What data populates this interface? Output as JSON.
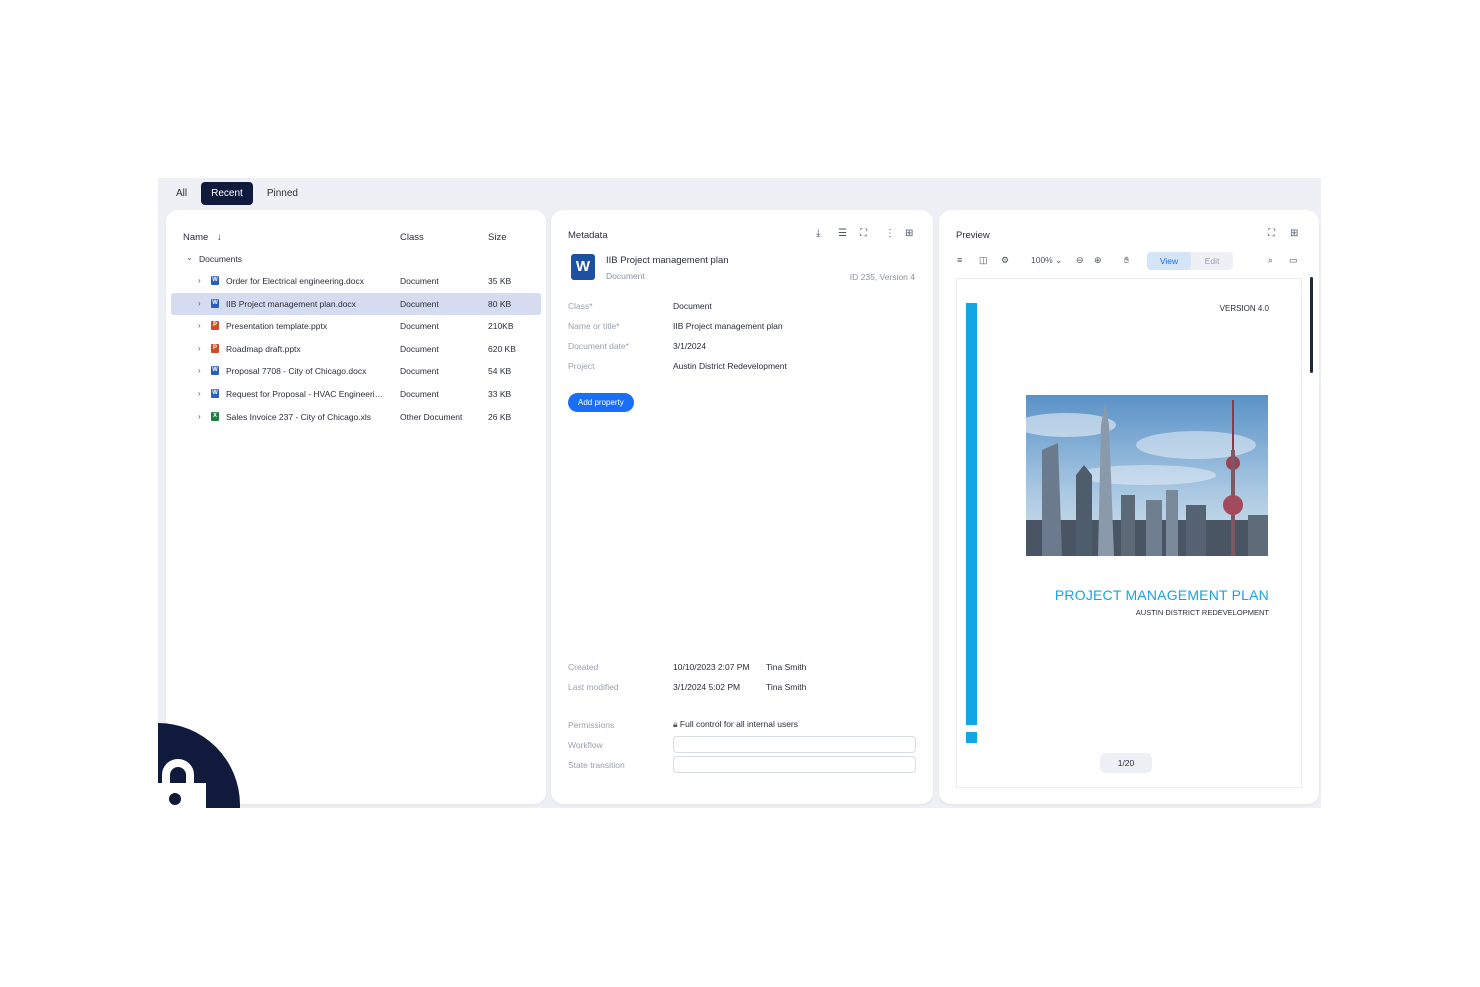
{
  "tabs": [
    "All",
    "Recent",
    "Pinned"
  ],
  "list": {
    "col_name": "Name",
    "sort_icon": "arrow-down",
    "col_class": "Class",
    "col_size": "Size",
    "folder": "Documents",
    "files": [
      {
        "name": "Order for Electrical engineering.docx",
        "class": "Document",
        "size": "35 KB",
        "type": "word",
        "color": "#2b5fbd",
        "letter": "W"
      },
      {
        "name": "IIB Project management plan.docx",
        "class": "Document",
        "size": "80 KB",
        "type": "word",
        "color": "#2b5fbd",
        "letter": "W"
      },
      {
        "name": "Presentation template.pptx",
        "class": "Document",
        "size": "210KB",
        "type": "powerpoint",
        "color": "#d04a23",
        "letter": "P"
      },
      {
        "name": "Roadmap draft.pptx",
        "class": "Document",
        "size": "620 KB",
        "type": "powerpoint",
        "color": "#d04a23",
        "letter": "P"
      },
      {
        "name": "Proposal 7708 - City of Chicago.docx",
        "class": "Document",
        "size": "54 KB",
        "type": "word",
        "color": "#2b5fbd",
        "letter": "W"
      },
      {
        "name": "Request for Proposal - HVAC Engineerin...",
        "class": "Document",
        "size": "33 KB",
        "type": "word",
        "color": "#2b5fbd",
        "letter": "W"
      },
      {
        "name": "Sales Invoice 237 - City of Chicago.xls",
        "class": "Other Document",
        "size": "26 KB",
        "type": "excel",
        "color": "#1e7d45",
        "letter": "X"
      }
    ]
  },
  "metadata": {
    "title": "Metadata",
    "doc_icon_letter": "W",
    "doc_title": "IIB Project management plan",
    "doc_class": "Document",
    "doc_id": "ID 235, Version 4",
    "props": [
      {
        "label": "Class*",
        "value": "Document"
      },
      {
        "label": "Name or title*",
        "value": "IIB Project management plan"
      },
      {
        "label": "Document date*",
        "value": "3/1/2024"
      },
      {
        "label": "Project",
        "value": "Austin District Redevelopment"
      }
    ],
    "add_property": "Add property",
    "created_label": "Created",
    "created_date": "10/10/2023 2:07 PM",
    "created_by": "Tina Smith",
    "modified_label": "Last modified",
    "modified_date": "3/1/2024 5:02 PM",
    "modified_by": "Tina Smith",
    "permissions_label": "Permissions",
    "permissions_value": "Full control for all internal users",
    "workflow_label": "Workflow",
    "workflow_value": "",
    "state_label": "State transition",
    "state_value": ""
  },
  "preview": {
    "title": "Preview",
    "zoom": "100%",
    "view": "View",
    "edit": "Edit",
    "version": "VERSION 4.0",
    "doc_heading": "PROJECT MANAGEMENT PLAN",
    "doc_subheading": "AUSTIN DISTRICT REDEVELOPMENT",
    "page_indicator": "1/20",
    "accent_color": "#11a6e4"
  },
  "accent": "#1a6ef5",
  "selected_tab": "Recent",
  "selected_file": "IIB Project management plan.docx"
}
